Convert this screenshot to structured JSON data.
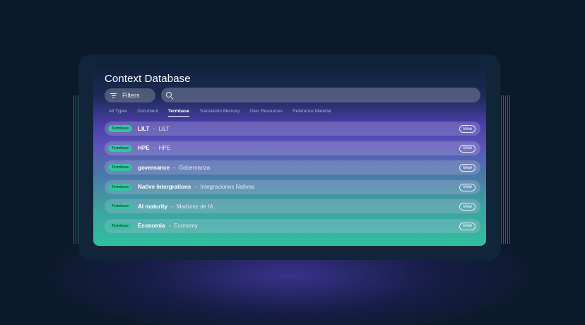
{
  "panel": {
    "title": "Context Database",
    "filters_label": "Filters",
    "search": {
      "value": "",
      "placeholder": ""
    }
  },
  "tabs": [
    {
      "label": "All Types",
      "active": false
    },
    {
      "label": "Document",
      "active": false
    },
    {
      "label": "Termbase",
      "active": true
    },
    {
      "label": "Translation Memory",
      "active": false
    },
    {
      "label": "User Resources",
      "active": false
    },
    {
      "label": "Reference Material",
      "active": false
    }
  ],
  "rows": [
    {
      "badge": "Termbase",
      "term": "LILT",
      "arrow": "→",
      "translation": "LILT",
      "action": "View"
    },
    {
      "badge": "Termbase",
      "term": "HPE",
      "arrow": "→",
      "translation": "HPE",
      "action": "View"
    },
    {
      "badge": "Termbase",
      "term": "governance",
      "arrow": "→",
      "translation": "Gobernanza",
      "action": "View"
    },
    {
      "badge": "Termbase",
      "term": "Native Intergrations",
      "arrow": "→",
      "translation": "Integraciones Nativas",
      "action": "View"
    },
    {
      "badge": "Termbase",
      "term": "AI maturity",
      "arrow": "→",
      "translation": "Madurez de IA",
      "action": "View"
    },
    {
      "badge": "Termbase",
      "term": "Economia",
      "arrow": "→",
      "translation": "Economy",
      "action": "View"
    }
  ],
  "colors": {
    "background": "#0b1a2a",
    "badge": "#35c3a0",
    "accent_purple": "#5a55b8",
    "accent_teal": "#2fc0a0"
  },
  "icons": {
    "filters": "filter-lines-icon",
    "search": "search-icon"
  }
}
